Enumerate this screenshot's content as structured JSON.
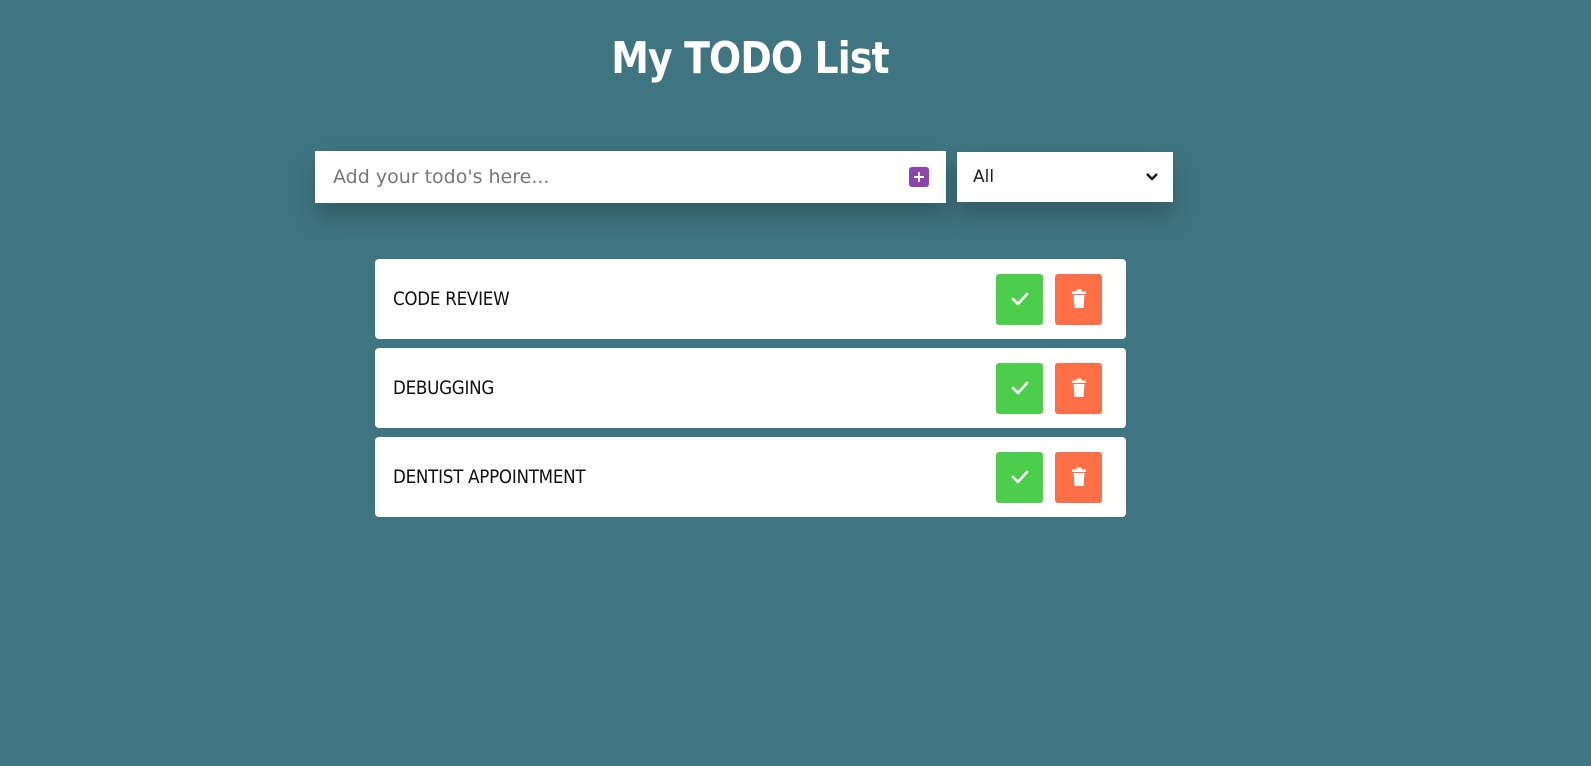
{
  "header": {
    "title": "My TODO List"
  },
  "form": {
    "input_placeholder": "Add your todo's here...",
    "input_value": "",
    "add_icon": "plus-square-icon",
    "filter": {
      "selected": "All"
    }
  },
  "todos": [
    {
      "text": "CODE REVIEW"
    },
    {
      "text": "DEBUGGING"
    },
    {
      "text": "DENTIST APPOINTMENT"
    }
  ],
  "colors": {
    "background": "#3f7580",
    "add_button": "#8e44ad",
    "complete_button": "#4cce4c",
    "trash_button": "#ff6f47"
  }
}
